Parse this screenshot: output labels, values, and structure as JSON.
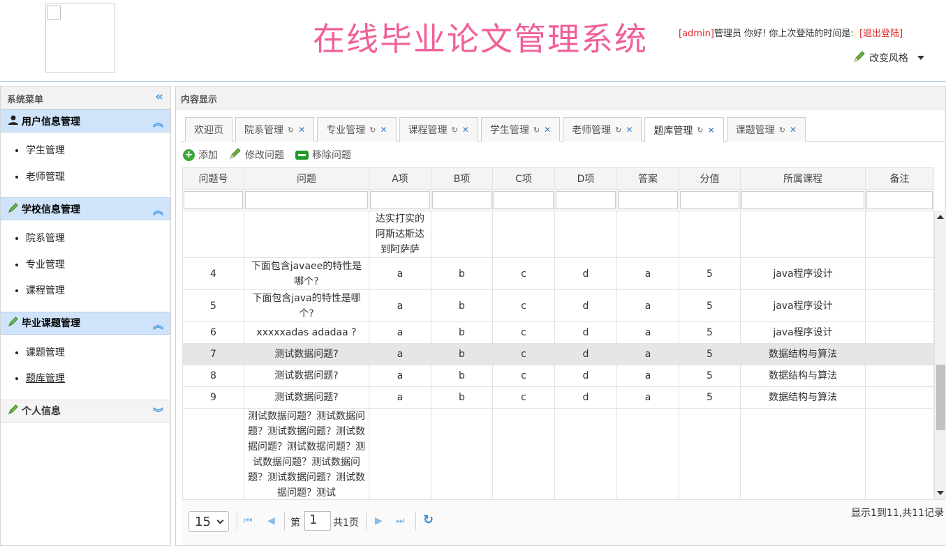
{
  "header": {
    "title": "在线毕业论文管理系统",
    "user_prefix": "[admin]",
    "user_greeting": "管理员 你好! 你上次登陆的时间是:",
    "logout": "[退出登陆]",
    "style_switch": "改变风格"
  },
  "sidebar": {
    "title": "系统菜单",
    "groups": [
      {
        "label": "用户信息管理",
        "items": [
          "学生管理",
          "老师管理"
        ]
      },
      {
        "label": "学校信息管理",
        "items": [
          "院系管理",
          "专业管理",
          "课程管理"
        ]
      },
      {
        "label": "毕业课题管理",
        "items": [
          "课题管理",
          "题库管理"
        ]
      },
      {
        "label": "个人信息",
        "items": []
      }
    ]
  },
  "content": {
    "title": "内容显示",
    "tabs": [
      "欢迎页",
      "院系管理",
      "专业管理",
      "课程管理",
      "学生管理",
      "老师管理",
      "题库管理",
      "课题管理"
    ],
    "active_tab": "题库管理"
  },
  "toolbar": {
    "add": "添加",
    "edit": "修改问题",
    "remove": "移除问题"
  },
  "table": {
    "columns": [
      "问题号",
      "问题",
      "A项",
      "B项",
      "C项",
      "D项",
      "答案",
      "分值",
      "所属课程",
      "备注"
    ],
    "rows": [
      [
        "",
        "",
        "达实打实的阿斯达斯达到阿萨萨",
        "",
        "",
        "",
        "",
        "",
        "",
        ""
      ],
      [
        "4",
        "下面包含javaee的特性是哪个?",
        "a",
        "b",
        "c",
        "d",
        "a",
        "5",
        "java程序设计",
        ""
      ],
      [
        "5",
        "下面包含java的特性是哪个?",
        "a",
        "b",
        "c",
        "d",
        "a",
        "5",
        "java程序设计",
        ""
      ],
      [
        "6",
        "xxxxxadas adadaa ?",
        "a",
        "b",
        "c",
        "d",
        "a",
        "5",
        "java程序设计",
        ""
      ],
      [
        "7",
        "测试数据问题?",
        "a",
        "b",
        "c",
        "d",
        "a",
        "5",
        "数据结构与算法",
        ""
      ],
      [
        "8",
        "测试数据问题?",
        "a",
        "b",
        "c",
        "d",
        "a",
        "5",
        "数据结构与算法",
        ""
      ],
      [
        "9",
        "测试数据问题?",
        "a",
        "b",
        "c",
        "d",
        "a",
        "5",
        "数据结构与算法",
        ""
      ],
      [
        "",
        "测试数据问题？测试数据问题？测试数据问题？测试数据问题？测试数据问题？测试数据问题？测试数据问题？测试数据问题？测试数据问题？测试",
        "",
        "",
        "",
        "",
        "",
        "",
        "",
        ""
      ]
    ]
  },
  "pager": {
    "page_size": "15",
    "page_label": "第",
    "page": "1",
    "total_pages": "共1页",
    "info": "显示1到11,共11记录"
  },
  "colors": {
    "title": "#f0609a",
    "accent": "#cfe4fb",
    "link": "#e02828"
  }
}
